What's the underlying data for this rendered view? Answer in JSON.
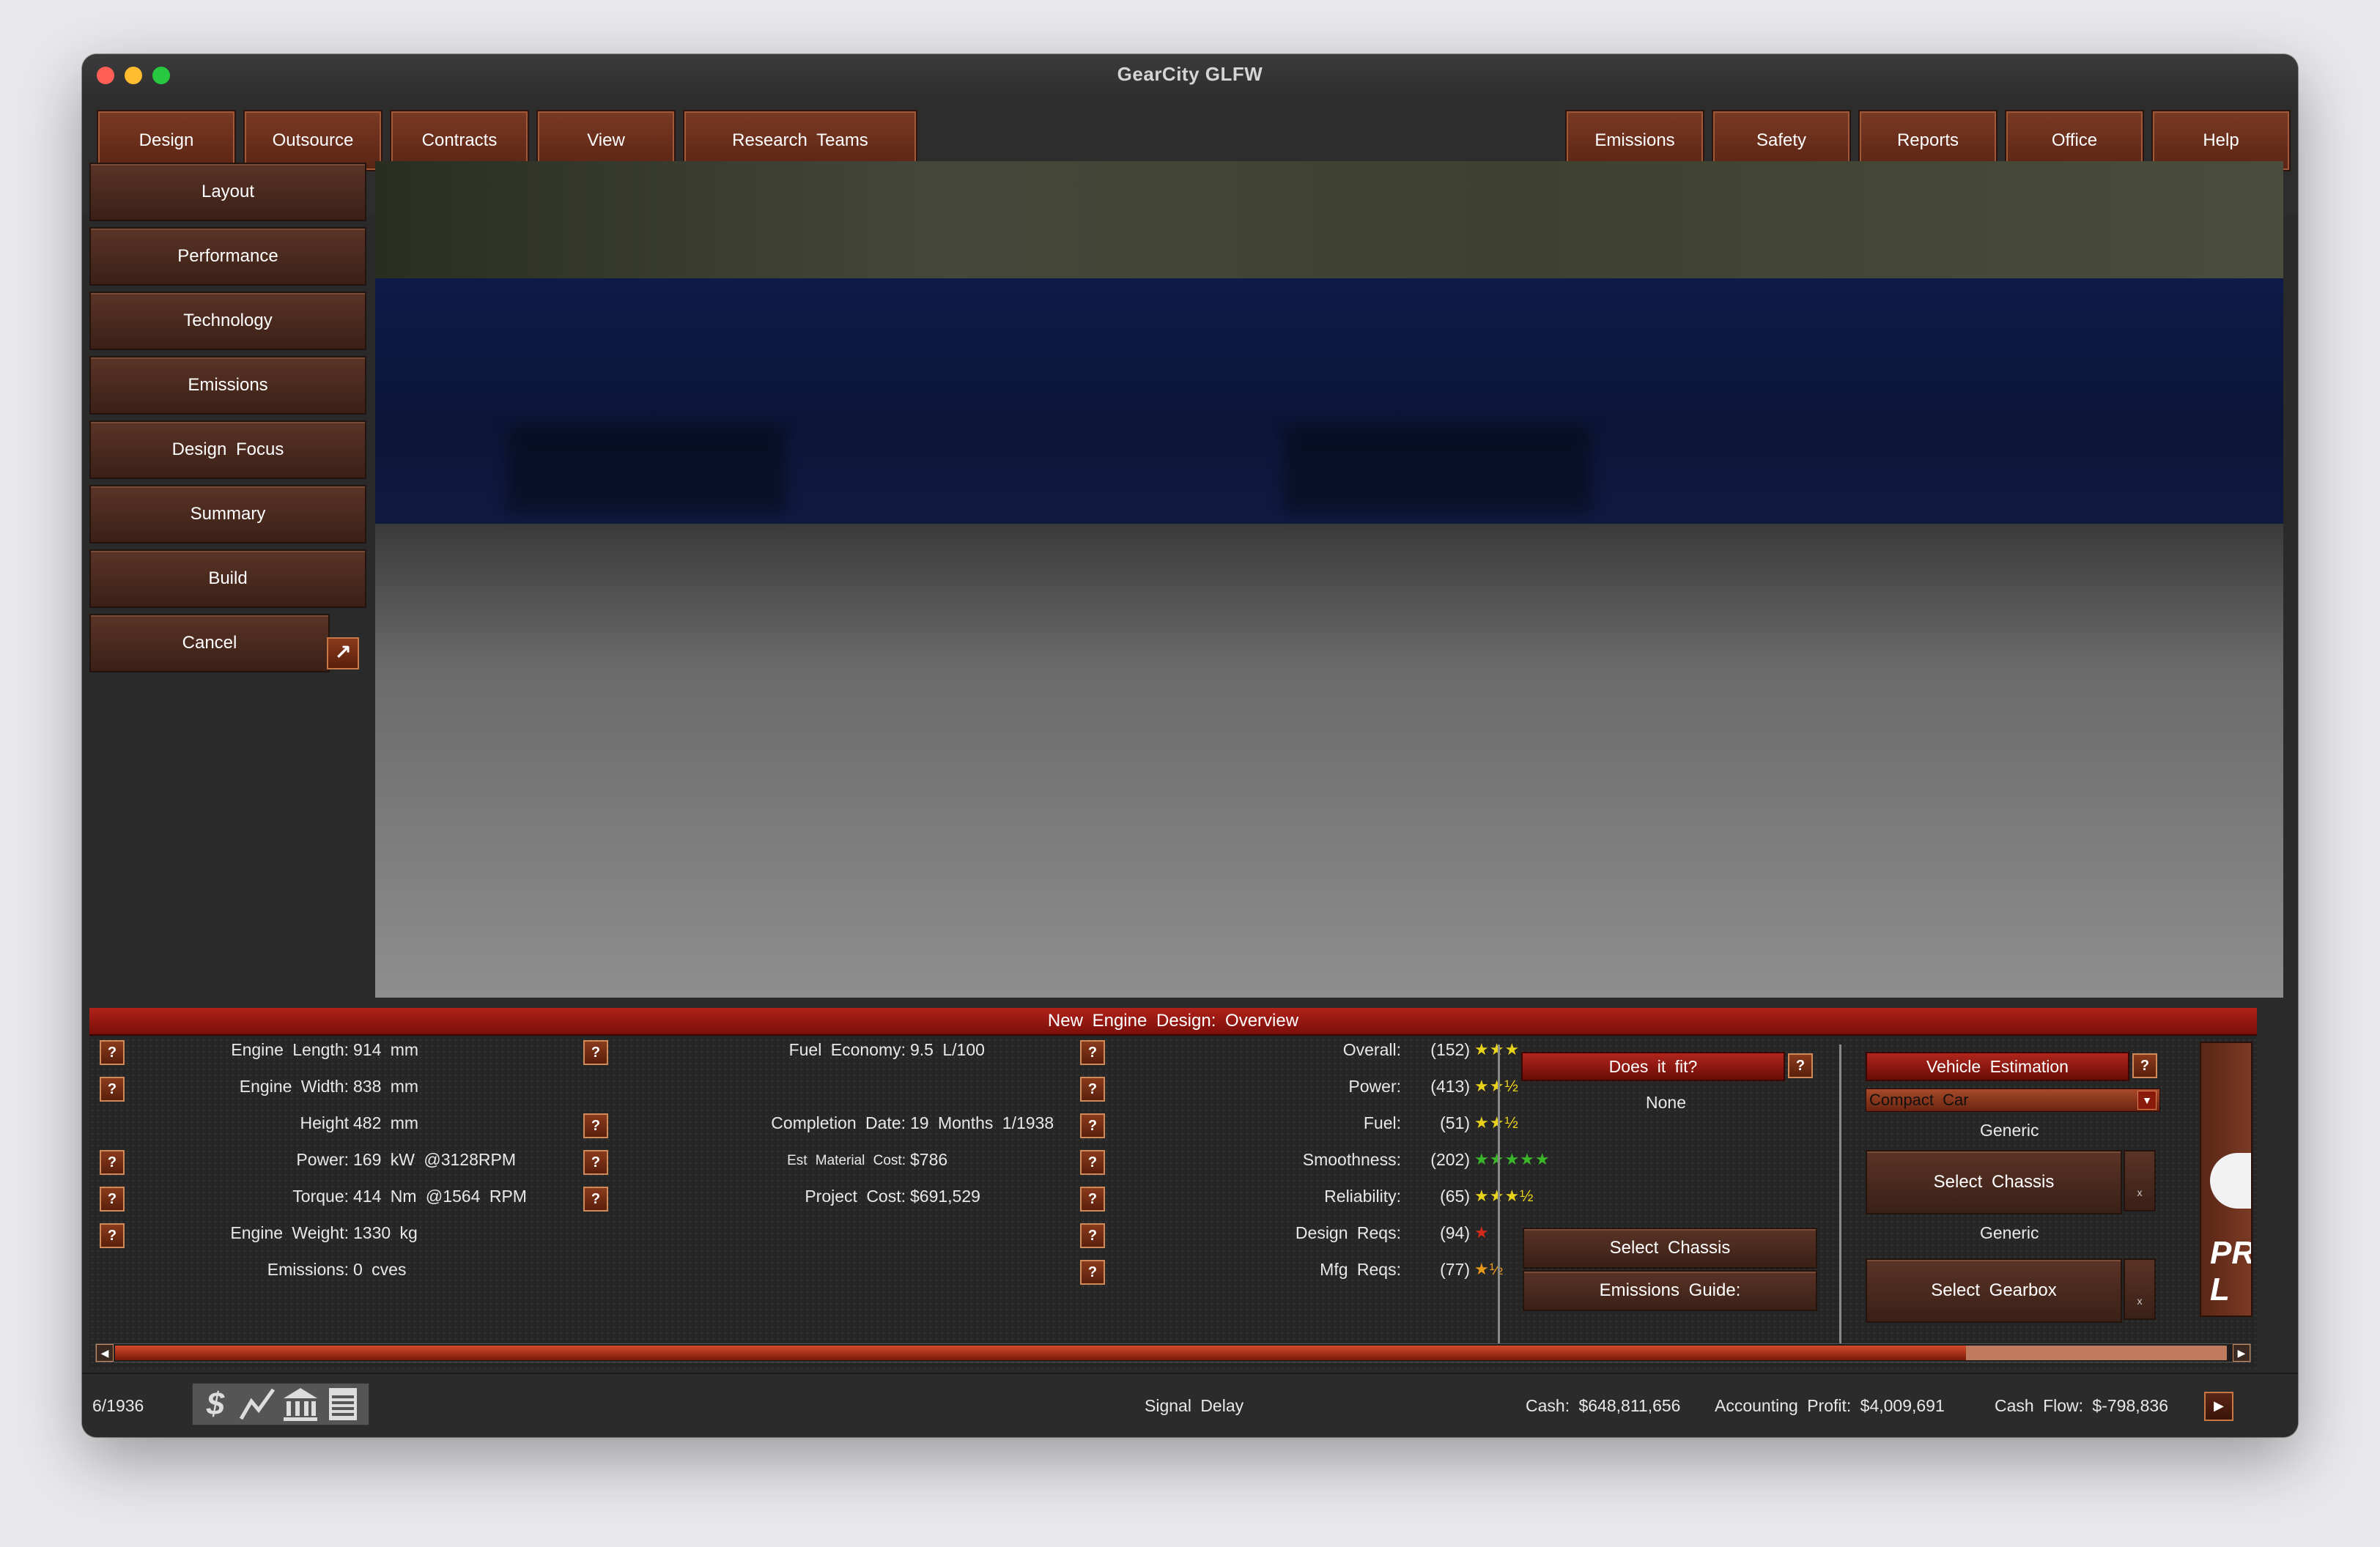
{
  "window": {
    "title": "GearCity GLFW"
  },
  "top_menu": {
    "left": [
      "Design",
      "Outsource",
      "Contracts",
      "View",
      "Research  Teams"
    ],
    "right": [
      "Emissions",
      "Safety",
      "Reports",
      "Office",
      "Help"
    ]
  },
  "side_menu": [
    "Layout",
    "Performance",
    "Technology",
    "Emissions",
    "Design  Focus",
    "Summary",
    "Build",
    "Cancel"
  ],
  "panel": {
    "title": "New  Engine  Design:  Overview",
    "specs": {
      "length_label": "Engine  Length:",
      "length_value": "914  mm",
      "width_label": "Engine  Width:",
      "width_value": "838  mm",
      "height_label": "Height",
      "height_value": "482  mm",
      "power_label": "Power:",
      "power_value": "169  kW  @3128RPM",
      "torque_label": "Torque:",
      "torque_value": "414  Nm  @1564  RPM",
      "weight_label": "Engine  Weight:",
      "weight_value": "1330  kg",
      "emissions_label": "Emissions:",
      "emissions_value": "0  cves"
    },
    "costs": {
      "fuel_label": "Fuel  Economy:",
      "fuel_value": "9.5  L/100",
      "completion_label": "Completion  Date:",
      "completion_value": "19  Months  1/1938",
      "material_label": "Est  Material  Cost:",
      "material_value": "$786",
      "project_label": "Project  Cost:",
      "project_value": "$691,529"
    },
    "ratings": [
      {
        "label": "Overall:",
        "value": "(152)",
        "stars": "★★★",
        "color": "#e8d21a"
      },
      {
        "label": "Power:",
        "value": "(413)",
        "stars": "★★½",
        "color": "#e8d21a"
      },
      {
        "label": "Fuel:",
        "value": "(51)",
        "stars": "★★½",
        "color": "#e8d21a"
      },
      {
        "label": "Smoothness:",
        "value": "(202)",
        "stars": "★★★★★",
        "color": "#3ab82a"
      },
      {
        "label": "Reliability:",
        "value": "(65)",
        "stars": "★★★½",
        "color": "#e8d21a"
      },
      {
        "label": "Design  Reqs:",
        "value": "(94)",
        "stars": "★",
        "color": "#d42a1a"
      },
      {
        "label": "Mfg  Reqs:",
        "value": "(77)",
        "stars": "★½",
        "color": "#e89a1a"
      }
    ],
    "fit": {
      "title": "Does  it  fit?",
      "value": "None",
      "select_chassis": "Select  Chassis",
      "emissions_guide": "Emissions  Guide:"
    },
    "vehicle": {
      "title": "Vehicle  Estimation",
      "selected_type": "Compact  Car",
      "chassis_generic": "Generic",
      "select_chassis": "Select  Chassis",
      "gearbox_generic": "Generic",
      "select_gearbox": "Select  Gearbox",
      "x": "x",
      "logo_text": "PR\nL"
    }
  },
  "status": {
    "date": "6/1936",
    "signal": "Signal  Delay",
    "cash": "Cash:  $648,811,656",
    "profit": "Accounting  Profit:  $4,009,691",
    "cashflow": "Cash  Flow:  $-798,836",
    "icons": [
      "dollar-icon",
      "chart-icon",
      "bank-icon",
      "bill-icon"
    ]
  }
}
